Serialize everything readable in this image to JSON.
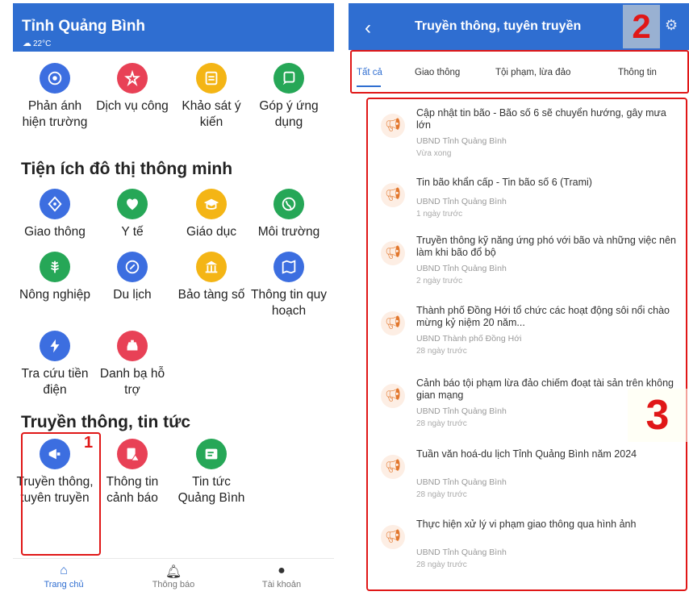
{
  "left": {
    "header": {
      "title": "Tỉnh Quảng Bình",
      "weather": "22°C"
    },
    "row1": [
      {
        "label": "Phản ánh hiện trường",
        "icon": "camera-feedback-icon",
        "color": "#3c6ee0"
      },
      {
        "label": "Dịch vụ công",
        "icon": "services-icon",
        "color": "#e84156"
      },
      {
        "label": "Khảo sát ý kiến",
        "icon": "survey-icon",
        "color": "#f4b515"
      },
      {
        "label": "Góp ý ứng dụng",
        "icon": "feedback-icon",
        "color": "#26a757"
      }
    ],
    "section_smart": "Tiện ích đô thị thông minh",
    "smart": [
      {
        "label": "Giao thông",
        "icon": "traffic-icon",
        "color": "#3c6ee0"
      },
      {
        "label": "Y tế",
        "icon": "health-icon",
        "color": "#26a757"
      },
      {
        "label": "Giáo dục",
        "icon": "education-icon",
        "color": "#f4b515"
      },
      {
        "label": "Môi trường",
        "icon": "environment-icon",
        "color": "#26a757"
      },
      {
        "label": "Nông nghiệp",
        "icon": "agriculture-icon",
        "color": "#26a757"
      },
      {
        "label": "Du lịch",
        "icon": "tourism-icon",
        "color": "#3c6ee0"
      },
      {
        "label": "Bảo tàng số",
        "icon": "museum-icon",
        "color": "#f4b515"
      },
      {
        "label": "Thông tin quy hoạch",
        "icon": "planning-map-icon",
        "color": "#3c6ee0"
      },
      {
        "label": "Tra cứu tiền điện",
        "icon": "electricity-icon",
        "color": "#3c6ee0"
      },
      {
        "label": "Danh bạ hỗ trợ",
        "icon": "taxi-directory-icon",
        "color": "#e84156"
      }
    ],
    "section_news": "Truyền thông, tin tức",
    "news_items": [
      {
        "label": "Truyền thông, tuyên truyền",
        "icon": "megaphone-icon",
        "color": "#3c6ee0"
      },
      {
        "label": "Thông tin cảnh báo",
        "icon": "warning-doc-icon",
        "color": "#e84156"
      },
      {
        "label": "Tin tức Quảng Bình",
        "icon": "news-icon",
        "color": "#26a757"
      }
    ],
    "marker1": "1",
    "nav": {
      "home": "Trang chủ",
      "notify": "Thông báo",
      "account": "Tài khoản"
    }
  },
  "right": {
    "title": "Truyền thông, tuyên truyền",
    "marker2": "2",
    "marker3": "3",
    "tabs": [
      "Tất cả",
      "Giao thông",
      "Tội phạm, lừa đảo",
      "Thông tin"
    ],
    "news": [
      {
        "title": "Cập nhật tin bão - Bão số 6 sẽ chuyển hướng, gây mưa lớn",
        "source": "UBND Tỉnh Quảng Bình",
        "time": "Vừa xong"
      },
      {
        "title": "Tin bão khẩn cấp - Tin bão số 6 (Trami)",
        "source": "UBND Tỉnh Quảng Bình",
        "time": "1 ngày trước"
      },
      {
        "title": "Truyền thông kỹ năng ứng phó với bão và những việc nên làm khi bão đổ bộ",
        "source": "UBND Tỉnh Quảng Bình",
        "time": "2 ngày trước"
      },
      {
        "title": "Thành phố Đồng Hới tổ chức các hoạt động sôi nổi chào mừng kỷ niệm 20 năm...",
        "source": "UBND Thành phố Đồng Hới",
        "time": "28 ngày trước"
      },
      {
        "title": "Cảnh báo tội phạm lừa đảo chiếm đoạt tài sản trên không gian mạng",
        "source": "UBND Tỉnh Quảng Bình",
        "time": "28 ngày trước"
      },
      {
        "title": "Tuần văn hoá-du lịch Tỉnh Quảng Bình năm 2024",
        "source": "UBND Tỉnh Quảng Bình",
        "time": "28 ngày trước"
      },
      {
        "title": "Thực hiện xử lý vi phạm giao thông qua hình ảnh",
        "source": "UBND Tỉnh Quảng Bình",
        "time": "28 ngày trước"
      }
    ]
  }
}
